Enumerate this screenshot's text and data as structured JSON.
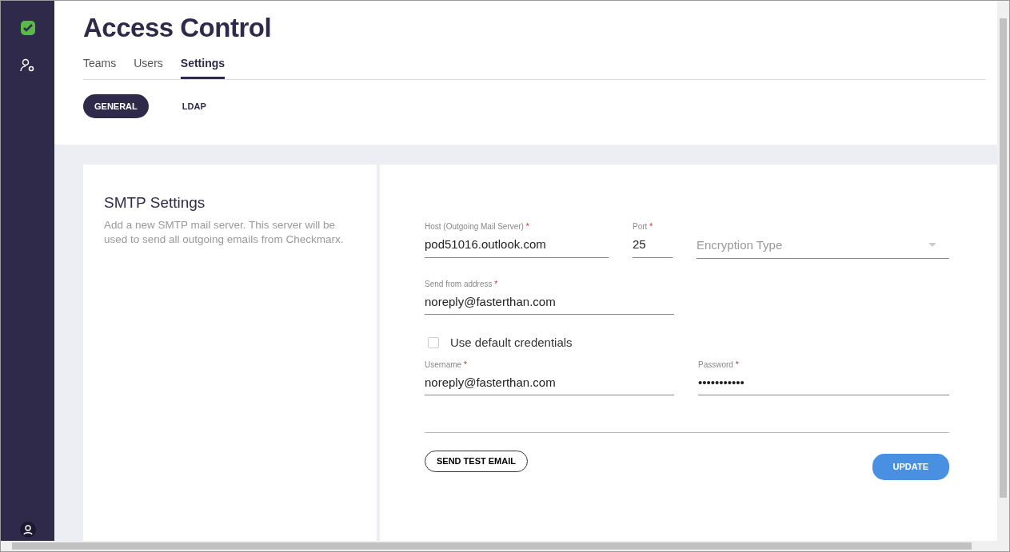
{
  "page": {
    "title": "Access Control"
  },
  "tabs": [
    {
      "label": "Teams",
      "selected": false
    },
    {
      "label": "Users",
      "selected": false
    },
    {
      "label": "Settings",
      "selected": true
    }
  ],
  "subtabs": [
    {
      "label": "GENERAL",
      "selected": true
    },
    {
      "label": "LDAP",
      "selected": false
    }
  ],
  "info": {
    "title": "SMTP Settings",
    "description": "Add a new SMTP mail server. This server will be used to send all outgoing emails from Checkmarx."
  },
  "form": {
    "host": {
      "label": "Host (Outgoing Mail Server)",
      "required": "*",
      "value": "pod51016.outlook.com"
    },
    "port": {
      "label": "Port",
      "required": "*",
      "value": "25"
    },
    "encryption": {
      "placeholder": "Encryption Type"
    },
    "from": {
      "label": "Send from address",
      "required": "*",
      "value": "noreply@fasterthan.com"
    },
    "default_credentials": {
      "label": "Use default credentials",
      "checked": false
    },
    "username": {
      "label": "Username",
      "required": "*",
      "value": "noreply@fasterthan.com"
    },
    "password": {
      "label": "Password",
      "required": "*",
      "value": "•••••••••••"
    }
  },
  "buttons": {
    "test": "SEND TEST EMAIL",
    "update": "UPDATE"
  }
}
